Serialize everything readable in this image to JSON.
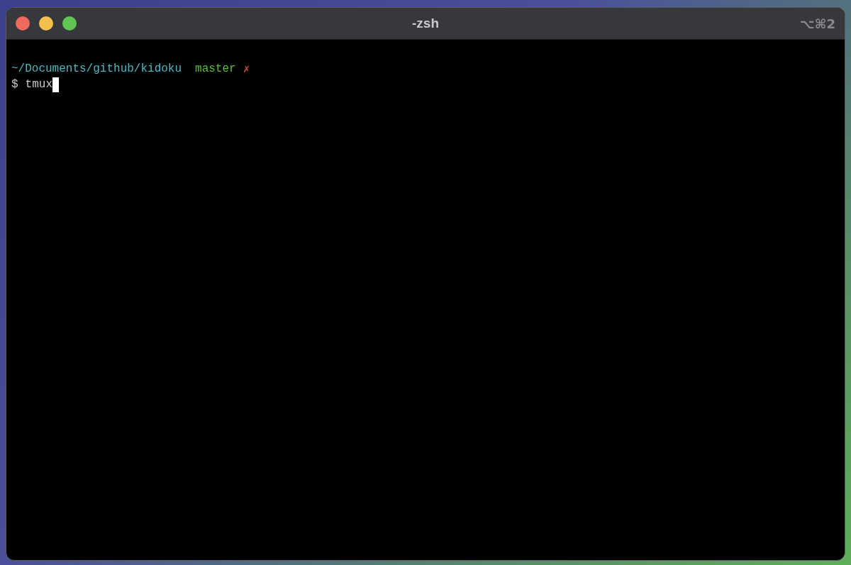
{
  "window": {
    "title": "-zsh",
    "shortcut": "⌥⌘2"
  },
  "terminal": {
    "path": "~/Documents/github/kidoku",
    "branch": "master",
    "dirty_mark": "✗",
    "prompt": "$",
    "command": "tmux",
    "cursor": true
  }
}
